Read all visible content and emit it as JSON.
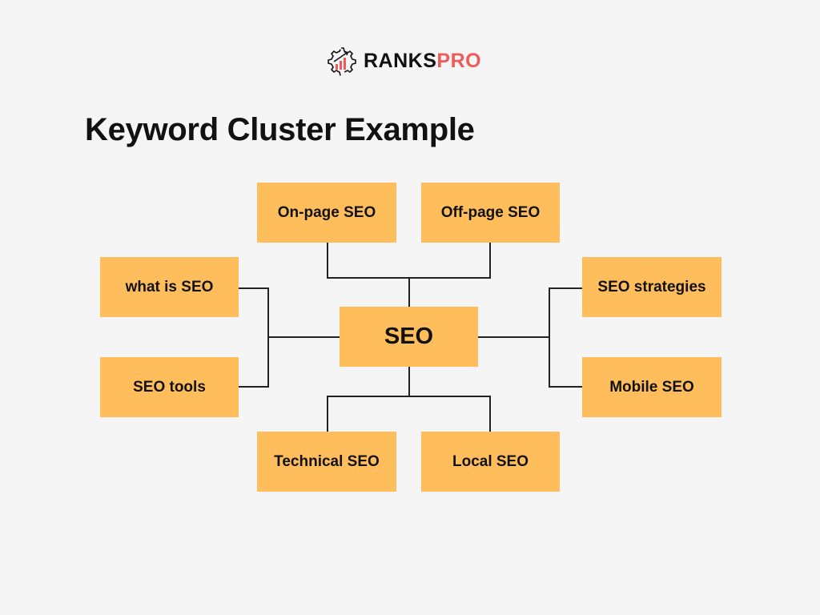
{
  "brand": {
    "name_part1": "RANKS",
    "name_part2": "PRO",
    "icon": "gear-chart-icon",
    "colors": {
      "dark": "#111111",
      "accent": "#f05a5a"
    }
  },
  "title": "Keyword Cluster Example",
  "diagram": {
    "center": "SEO",
    "nodes": {
      "top_left": "On-page SEO",
      "top_right": "Off-page SEO",
      "left_top": "what is SEO",
      "left_bottom": "SEO tools",
      "right_top": "SEO strategies",
      "right_bottom": "Mobile SEO",
      "bottom_left": "Technical SEO",
      "bottom_right": "Local SEO"
    },
    "colors": {
      "box": "#ffbe5b",
      "line": "#222222",
      "background": "#f5f5f5"
    }
  }
}
